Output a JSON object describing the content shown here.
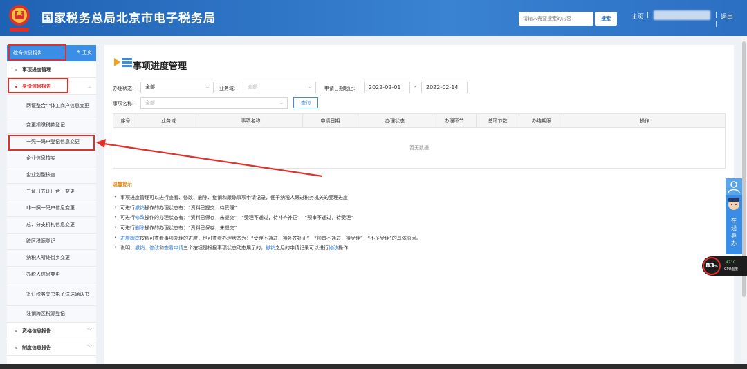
{
  "header": {
    "title": "国家税务总局北京市电子税务局",
    "search_placeholder": "请输入需要搜索的内容",
    "search_button": "搜索",
    "home": "主页",
    "logout": "退出",
    "separator": "|"
  },
  "sidebar": {
    "top_label": "综合信息报告",
    "top_home": "主页",
    "items": [
      {
        "label": "事项进度管理"
      },
      {
        "label": "身份信息报告"
      },
      {
        "label": "两证整合个体工商户信息变更"
      },
      {
        "label": "变更扣缴税款登记"
      },
      {
        "label": "一照一码户登记信息变更"
      },
      {
        "label": "企业信息核实"
      },
      {
        "label": "企业划型核查"
      },
      {
        "label": "三证（五证）合一变更"
      },
      {
        "label": "非一照一码户信息变更"
      },
      {
        "label": "总、分支机构信息变更"
      },
      {
        "label": "跨区税源登记"
      },
      {
        "label": "纳税人所处街乡变更"
      },
      {
        "label": "办税人信息变更"
      },
      {
        "label": "签订税务文书电子送达确认书"
      },
      {
        "label": "注销跨区税源登记"
      },
      {
        "label": "资格信息报告"
      },
      {
        "label": "制度信息报告"
      }
    ]
  },
  "main": {
    "title": "事项进度管理",
    "filters": {
      "status_label": "办理状态:",
      "status_value": "全部",
      "domain_label": "业务域:",
      "domain_value": "全部",
      "date_label": "申请日期起止:",
      "date_from": "2022-02-01",
      "date_sep": "-",
      "date_to": "2022-02-14",
      "name_label": "事项名称:",
      "name_value": "全部",
      "query_button": "查询"
    },
    "table": {
      "columns": [
        "序号",
        "业务域",
        "事项名称",
        "申请日期",
        "办理状态",
        "办理环节",
        "总环节数",
        "办结期限",
        "操作"
      ],
      "empty_text": "暂无数据"
    },
    "tips": {
      "title": "温馨提示",
      "lines": [
        {
          "parts": [
            {
              "t": "事项进度管理可以进行查看、修改、删除、撤销和跟踪事项申请记录，便于纳税人跟进税务机关的受理进度"
            }
          ]
        },
        {
          "parts": [
            {
              "t": "可进行"
            },
            {
              "t": "撤销",
              "b": true
            },
            {
              "t": "操作的办理状态有：“资料已提交，待受理”"
            }
          ]
        },
        {
          "parts": [
            {
              "t": "可进行"
            },
            {
              "t": "修改",
              "b": true
            },
            {
              "t": "操作的办理状态有：“资料已保存，未提交”　“受理不通过，待补齐补正”　“预审不通过，待受理”"
            }
          ]
        },
        {
          "parts": [
            {
              "t": "可进行"
            },
            {
              "t": "删除",
              "b": true
            },
            {
              "t": "操作的办理状态有：“资料已保存，未提交”"
            }
          ]
        },
        {
          "parts": [
            {
              "t": "进度跟踪",
              "b": true
            },
            {
              "t": "按钮可查看事项办理的进度，也可查看办理状态为：“受理不通过，待补齐补正”　“预审不通过，待受理”　“不予受理”的具体原因。"
            }
          ]
        },
        {
          "parts": [
            {
              "t": "说明："
            },
            {
              "t": "撤销",
              "b": true
            },
            {
              "t": "、"
            },
            {
              "t": "修改",
              "b": true
            },
            {
              "t": "和"
            },
            {
              "t": "查看申请",
              "b": true
            },
            {
              "t": "三个按钮是根据事项状态动态展示的，"
            },
            {
              "t": "撤销",
              "b": true
            },
            {
              "t": "之后的申请记录可以进行"
            },
            {
              "t": "修改",
              "b": true
            },
            {
              "t": "操作"
            }
          ]
        }
      ]
    }
  },
  "widgets": {
    "online_guide": "在线导办",
    "cpu_percent": "83",
    "cpu_percent_sign": "%",
    "cpu_temp": "47°C",
    "cpu_label": "CPU温度"
  },
  "colors": {
    "header_blue": "#2d70c0",
    "accent_blue": "#3b8ee6",
    "annotation_red": "#e0302a",
    "tip_orange": "#e58b1a"
  }
}
